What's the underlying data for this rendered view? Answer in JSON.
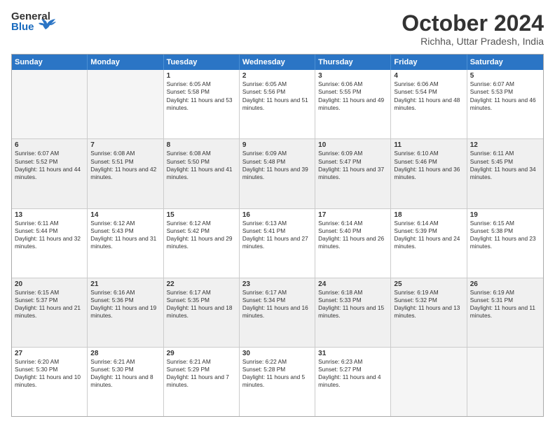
{
  "header": {
    "logo_general": "General",
    "logo_blue": "Blue",
    "month_title": "October 2024",
    "subtitle": "Richha, Uttar Pradesh, India"
  },
  "calendar": {
    "days_of_week": [
      "Sunday",
      "Monday",
      "Tuesday",
      "Wednesday",
      "Thursday",
      "Friday",
      "Saturday"
    ],
    "weeks": [
      [
        {
          "day": "",
          "sunrise": "",
          "sunset": "",
          "daylight": "",
          "empty": true
        },
        {
          "day": "",
          "sunrise": "",
          "sunset": "",
          "daylight": "",
          "empty": true
        },
        {
          "day": "1",
          "sunrise": "Sunrise: 6:05 AM",
          "sunset": "Sunset: 5:58 PM",
          "daylight": "Daylight: 11 hours and 53 minutes."
        },
        {
          "day": "2",
          "sunrise": "Sunrise: 6:05 AM",
          "sunset": "Sunset: 5:56 PM",
          "daylight": "Daylight: 11 hours and 51 minutes."
        },
        {
          "day": "3",
          "sunrise": "Sunrise: 6:06 AM",
          "sunset": "Sunset: 5:55 PM",
          "daylight": "Daylight: 11 hours and 49 minutes."
        },
        {
          "day": "4",
          "sunrise": "Sunrise: 6:06 AM",
          "sunset": "Sunset: 5:54 PM",
          "daylight": "Daylight: 11 hours and 48 minutes."
        },
        {
          "day": "5",
          "sunrise": "Sunrise: 6:07 AM",
          "sunset": "Sunset: 5:53 PM",
          "daylight": "Daylight: 11 hours and 46 minutes."
        }
      ],
      [
        {
          "day": "6",
          "sunrise": "Sunrise: 6:07 AM",
          "sunset": "Sunset: 5:52 PM",
          "daylight": "Daylight: 11 hours and 44 minutes."
        },
        {
          "day": "7",
          "sunrise": "Sunrise: 6:08 AM",
          "sunset": "Sunset: 5:51 PM",
          "daylight": "Daylight: 11 hours and 42 minutes."
        },
        {
          "day": "8",
          "sunrise": "Sunrise: 6:08 AM",
          "sunset": "Sunset: 5:50 PM",
          "daylight": "Daylight: 11 hours and 41 minutes."
        },
        {
          "day": "9",
          "sunrise": "Sunrise: 6:09 AM",
          "sunset": "Sunset: 5:48 PM",
          "daylight": "Daylight: 11 hours and 39 minutes."
        },
        {
          "day": "10",
          "sunrise": "Sunrise: 6:09 AM",
          "sunset": "Sunset: 5:47 PM",
          "daylight": "Daylight: 11 hours and 37 minutes."
        },
        {
          "day": "11",
          "sunrise": "Sunrise: 6:10 AM",
          "sunset": "Sunset: 5:46 PM",
          "daylight": "Daylight: 11 hours and 36 minutes."
        },
        {
          "day": "12",
          "sunrise": "Sunrise: 6:11 AM",
          "sunset": "Sunset: 5:45 PM",
          "daylight": "Daylight: 11 hours and 34 minutes."
        }
      ],
      [
        {
          "day": "13",
          "sunrise": "Sunrise: 6:11 AM",
          "sunset": "Sunset: 5:44 PM",
          "daylight": "Daylight: 11 hours and 32 minutes."
        },
        {
          "day": "14",
          "sunrise": "Sunrise: 6:12 AM",
          "sunset": "Sunset: 5:43 PM",
          "daylight": "Daylight: 11 hours and 31 minutes."
        },
        {
          "day": "15",
          "sunrise": "Sunrise: 6:12 AM",
          "sunset": "Sunset: 5:42 PM",
          "daylight": "Daylight: 11 hours and 29 minutes."
        },
        {
          "day": "16",
          "sunrise": "Sunrise: 6:13 AM",
          "sunset": "Sunset: 5:41 PM",
          "daylight": "Daylight: 11 hours and 27 minutes."
        },
        {
          "day": "17",
          "sunrise": "Sunrise: 6:14 AM",
          "sunset": "Sunset: 5:40 PM",
          "daylight": "Daylight: 11 hours and 26 minutes."
        },
        {
          "day": "18",
          "sunrise": "Sunrise: 6:14 AM",
          "sunset": "Sunset: 5:39 PM",
          "daylight": "Daylight: 11 hours and 24 minutes."
        },
        {
          "day": "19",
          "sunrise": "Sunrise: 6:15 AM",
          "sunset": "Sunset: 5:38 PM",
          "daylight": "Daylight: 11 hours and 23 minutes."
        }
      ],
      [
        {
          "day": "20",
          "sunrise": "Sunrise: 6:15 AM",
          "sunset": "Sunset: 5:37 PM",
          "daylight": "Daylight: 11 hours and 21 minutes."
        },
        {
          "day": "21",
          "sunrise": "Sunrise: 6:16 AM",
          "sunset": "Sunset: 5:36 PM",
          "daylight": "Daylight: 11 hours and 19 minutes."
        },
        {
          "day": "22",
          "sunrise": "Sunrise: 6:17 AM",
          "sunset": "Sunset: 5:35 PM",
          "daylight": "Daylight: 11 hours and 18 minutes."
        },
        {
          "day": "23",
          "sunrise": "Sunrise: 6:17 AM",
          "sunset": "Sunset: 5:34 PM",
          "daylight": "Daylight: 11 hours and 16 minutes."
        },
        {
          "day": "24",
          "sunrise": "Sunrise: 6:18 AM",
          "sunset": "Sunset: 5:33 PM",
          "daylight": "Daylight: 11 hours and 15 minutes."
        },
        {
          "day": "25",
          "sunrise": "Sunrise: 6:19 AM",
          "sunset": "Sunset: 5:32 PM",
          "daylight": "Daylight: 11 hours and 13 minutes."
        },
        {
          "day": "26",
          "sunrise": "Sunrise: 6:19 AM",
          "sunset": "Sunset: 5:31 PM",
          "daylight": "Daylight: 11 hours and 11 minutes."
        }
      ],
      [
        {
          "day": "27",
          "sunrise": "Sunrise: 6:20 AM",
          "sunset": "Sunset: 5:30 PM",
          "daylight": "Daylight: 11 hours and 10 minutes."
        },
        {
          "day": "28",
          "sunrise": "Sunrise: 6:21 AM",
          "sunset": "Sunset: 5:30 PM",
          "daylight": "Daylight: 11 hours and 8 minutes."
        },
        {
          "day": "29",
          "sunrise": "Sunrise: 6:21 AM",
          "sunset": "Sunset: 5:29 PM",
          "daylight": "Daylight: 11 hours and 7 minutes."
        },
        {
          "day": "30",
          "sunrise": "Sunrise: 6:22 AM",
          "sunset": "Sunset: 5:28 PM",
          "daylight": "Daylight: 11 hours and 5 minutes."
        },
        {
          "day": "31",
          "sunrise": "Sunrise: 6:23 AM",
          "sunset": "Sunset: 5:27 PM",
          "daylight": "Daylight: 11 hours and 4 minutes."
        },
        {
          "day": "",
          "sunrise": "",
          "sunset": "",
          "daylight": "",
          "empty": true
        },
        {
          "day": "",
          "sunrise": "",
          "sunset": "",
          "daylight": "",
          "empty": true
        }
      ]
    ]
  }
}
